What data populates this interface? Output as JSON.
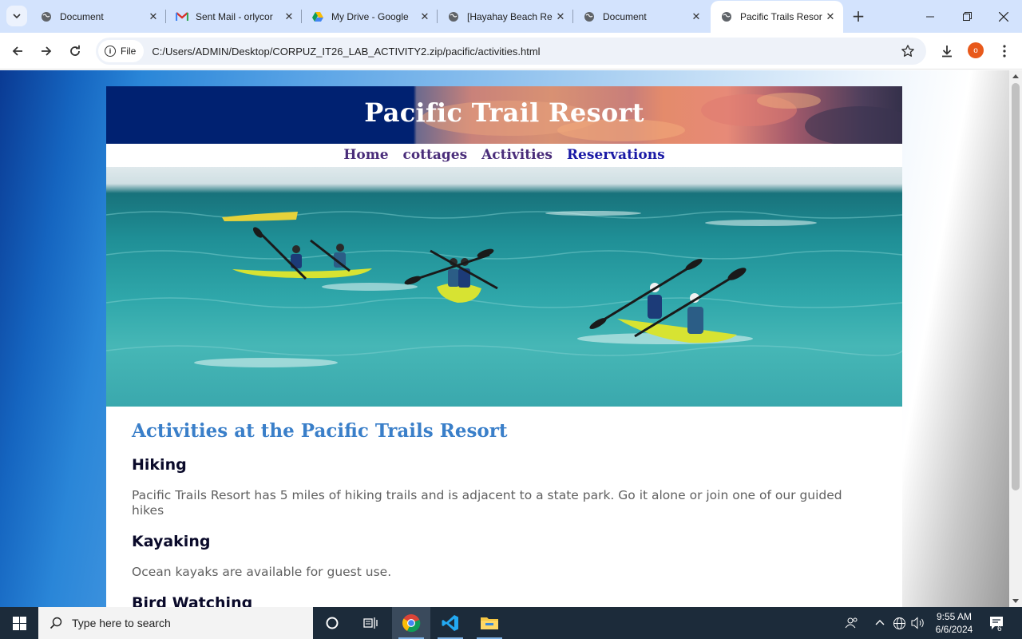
{
  "browser": {
    "tabs": [
      {
        "title": "Document",
        "icon": "globe-icon",
        "active": false
      },
      {
        "title": "Sent Mail - orlycor",
        "icon": "gmail-icon",
        "active": false
      },
      {
        "title": "My Drive - Google",
        "icon": "drive-icon",
        "active": false
      },
      {
        "title": "[Hayahay Beach Re",
        "icon": "globe-icon",
        "active": false
      },
      {
        "title": "Document",
        "icon": "globe-icon",
        "active": false
      },
      {
        "title": "Pacific Trails Resort",
        "icon": "globe-icon",
        "active": true
      }
    ],
    "address": {
      "chip_label": "File",
      "url": "C:/Users/ADMIN/Desktop/CORPUZ_IT26_LAB_ACTIVITY2.zip/pacific/activities.html"
    },
    "profile_initial": "o"
  },
  "page": {
    "site_title": "Pacific Trail Resort",
    "nav": [
      "Home",
      "cottages",
      "Activities",
      "Reservations"
    ],
    "heading": "Activities at the Pacific Trails Resort",
    "sections": [
      {
        "title": "Hiking",
        "text": "Pacific Trails Resort has 5 miles of hiking trails and is adjacent to a state park. Go it alone or join one of our guided hikes"
      },
      {
        "title": "Kayaking",
        "text": "Ocean kayaks are available for guest use."
      },
      {
        "title": "Bird Watching",
        "text": ""
      }
    ],
    "colors": {
      "header_navy": "#002171",
      "heading_blue": "#3a7fc9",
      "nav_purple": "#4a2d7a"
    }
  },
  "taskbar": {
    "search_placeholder": "Type here to search",
    "time": "9:55 AM",
    "date": "6/6/2024",
    "notification_count": "6"
  }
}
